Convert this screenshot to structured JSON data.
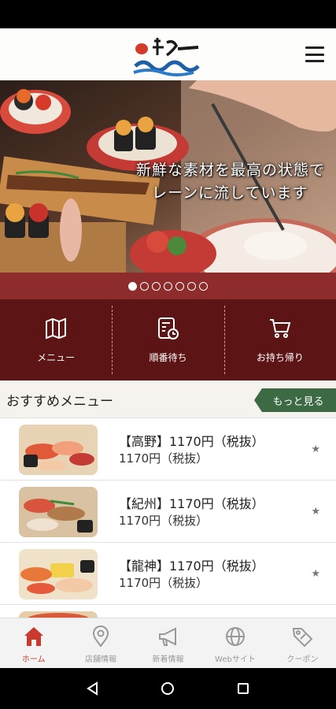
{
  "colors": {
    "brand_red": "#8e2b2b",
    "nav_dark": "#5c1414",
    "more_green": "#3c6a43",
    "tab_active": "#c83a2e",
    "tab_inactive": "#999999"
  },
  "header": {
    "menu_icon": "hamburger-icon"
  },
  "hero": {
    "line1": "新鮮な素材を最高の状態で",
    "line2": "レーンに流しています",
    "slide_count": 7,
    "active_slide": 0
  },
  "quick_nav": [
    {
      "label": "メニュー",
      "icon": "book-icon"
    },
    {
      "label": "順番待ち",
      "icon": "ticket-clock-icon"
    },
    {
      "label": "お持ち帰り",
      "icon": "cart-icon"
    }
  ],
  "recommend": {
    "title": "おすすめメニュー",
    "more_label": "もっと見る",
    "items": [
      {
        "name": "【高野】1170円（税抜）",
        "price": "1170円（税抜）"
      },
      {
        "name": "【紀州】1170円（税抜）",
        "price": "1170円（税抜）"
      },
      {
        "name": "【龍神】1170円（税抜）",
        "price": "1170円（税抜）"
      }
    ],
    "star_glyph": "★"
  },
  "tabs": [
    {
      "label": "ホーム",
      "icon": "home-icon"
    },
    {
      "label": "店舗情報",
      "icon": "location-icon"
    },
    {
      "label": "新着情報",
      "icon": "megaphone-icon"
    },
    {
      "label": "Webサイト",
      "icon": "globe-icon"
    },
    {
      "label": "クーポン",
      "icon": "coupon-icon"
    }
  ]
}
